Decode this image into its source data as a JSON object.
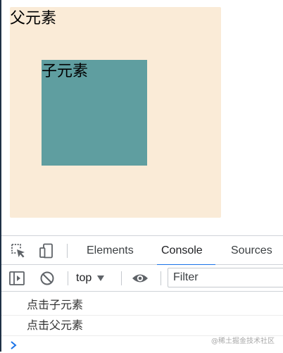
{
  "page": {
    "parent_label": "父元素",
    "child_label": "子元素",
    "colors": {
      "parent_bg": "#faebd7",
      "child_bg": "#5f9ea0"
    }
  },
  "devtools": {
    "icons": [
      "inspect-element-icon",
      "device-toolbar-icon",
      "sidebar-toggle-icon",
      "clear-console-icon",
      "eye-icon",
      "prompt-chevron-icon"
    ],
    "tabs": [
      {
        "label": "Elements",
        "active": false
      },
      {
        "label": "Console",
        "active": true
      },
      {
        "label": "Sources",
        "active": false
      }
    ],
    "toolbar": {
      "context": "top",
      "filter_placeholder": "Filter"
    },
    "console_messages": [
      "点击子元素",
      "点击父元素"
    ],
    "accent_color": "#1a73e8"
  },
  "watermark": "@稀土掘金技术社区"
}
